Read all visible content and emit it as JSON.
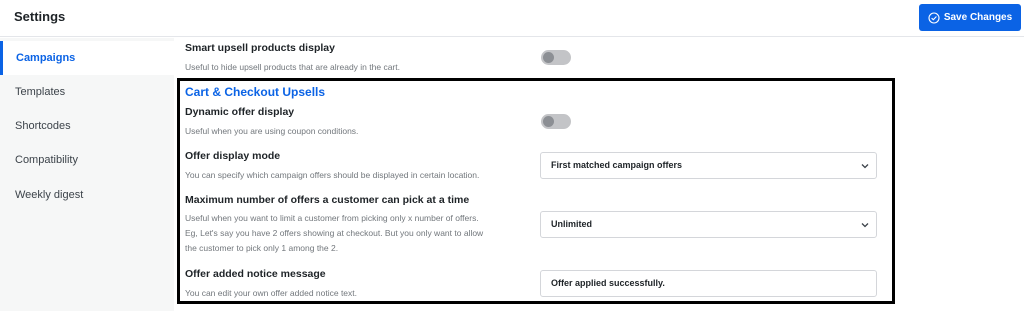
{
  "header": {
    "title": "Settings",
    "save_label": "Save Changes"
  },
  "sidebar": {
    "items": [
      {
        "label": "Campaigns",
        "active": true
      },
      {
        "label": "Templates"
      },
      {
        "label": "Shortcodes"
      },
      {
        "label": "Compatibility"
      },
      {
        "label": "Weekly digest"
      }
    ]
  },
  "settings": {
    "smart_upsell": {
      "title": "Smart upsell products display",
      "description": "Useful to hide upsell products that are already in the cart.",
      "enabled": false
    },
    "section_heading": "Cart & Checkout Upsells",
    "dynamic_offer": {
      "title": "Dynamic offer display",
      "description": "Useful when you are using coupon conditions.",
      "enabled": false
    },
    "offer_display_mode": {
      "title": "Offer display mode",
      "description": "You can specify which campaign offers should be displayed in certain location.",
      "value": "First matched campaign offers"
    },
    "max_offers": {
      "title": "Maximum number of offers a customer can pick at a time",
      "description_lines": [
        "Useful when you want to limit a customer from picking only x number of offers.",
        "Eg, Let's say you have 2 offers showing at checkout. But you only want to allow",
        "the customer to pick only 1 among the 2."
      ],
      "value": "Unlimited"
    },
    "offer_notice": {
      "title": "Offer added notice message",
      "description": "You can edit your own offer added notice text.",
      "value": "Offer applied successfully."
    }
  },
  "colors": {
    "accent": "#0b63e5",
    "highlight_border": "#000000"
  }
}
